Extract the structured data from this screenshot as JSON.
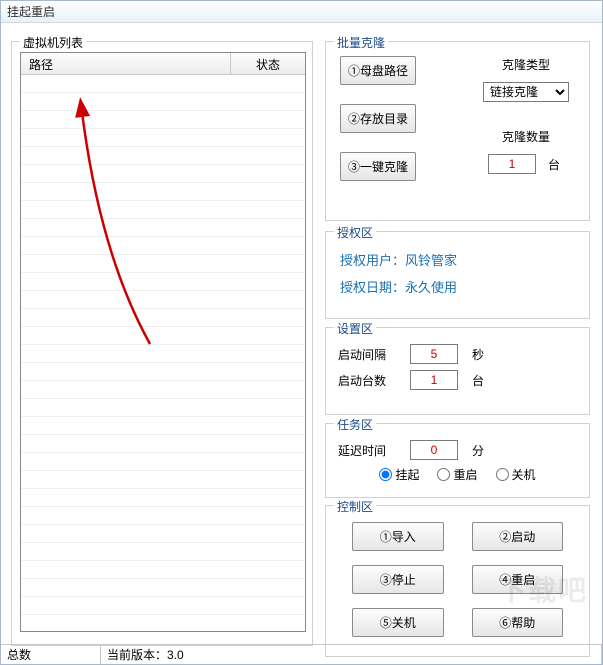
{
  "window": {
    "title": "挂起重启"
  },
  "vmlist": {
    "legend": "虚拟机列表",
    "col_path": "路径",
    "col_status": "状态"
  },
  "clone": {
    "legend": "批量克隆",
    "btn_master": "①母盘路径",
    "btn_storage": "②存放目录",
    "btn_oneclick": "③一键克隆",
    "type_label": "克隆类型",
    "type_value": "链接克隆",
    "qty_label": "克隆数量",
    "qty_value": "1",
    "qty_unit": "台"
  },
  "auth": {
    "legend": "授权区",
    "user_line": "授权用户：风铃管家",
    "date_line": "授权日期：永久使用"
  },
  "settings": {
    "legend": "设置区",
    "interval_label": "启动间隔",
    "interval_value": "5",
    "interval_unit": "秒",
    "count_label": "启动台数",
    "count_value": "1",
    "count_unit": "台"
  },
  "task": {
    "legend": "任务区",
    "delay_label": "延迟时间",
    "delay_value": "0",
    "delay_unit": "分",
    "radio_suspend": "挂起",
    "radio_restart": "重启",
    "radio_shutdown": "关机"
  },
  "ctrl": {
    "legend": "控制区",
    "import": "①导入",
    "start": "②启动",
    "stop": "③停止",
    "restart": "④重启",
    "shutdown": "⑤关机",
    "help": "⑥帮助"
  },
  "status": {
    "total_label": "总数",
    "version_label": "当前版本：3.0"
  },
  "watermark": "下载吧"
}
